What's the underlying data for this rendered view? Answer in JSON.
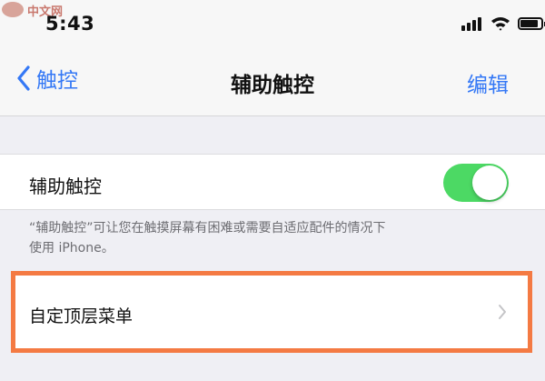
{
  "watermark": {
    "text": "中文网"
  },
  "status_bar": {
    "time": "5:43",
    "icons": [
      "signal-icon",
      "wifi-icon",
      "battery-icon"
    ]
  },
  "nav": {
    "back_label": "触控",
    "title": "辅助触控",
    "edit_label": "编辑"
  },
  "assistive_touch": {
    "label": "辅助触控",
    "enabled": true,
    "footnote_line1": "“辅助触控”可让您在触摸屏幕有困难或需要自适应配件的情况下",
    "footnote_line2": "使用 iPhone。"
  },
  "menu": {
    "customize_label": "自定顶层菜单"
  },
  "colors": {
    "accent": "#3478f6",
    "toggle_on": "#4cd964",
    "highlight": "#f47a43",
    "background": "#efeff4"
  }
}
